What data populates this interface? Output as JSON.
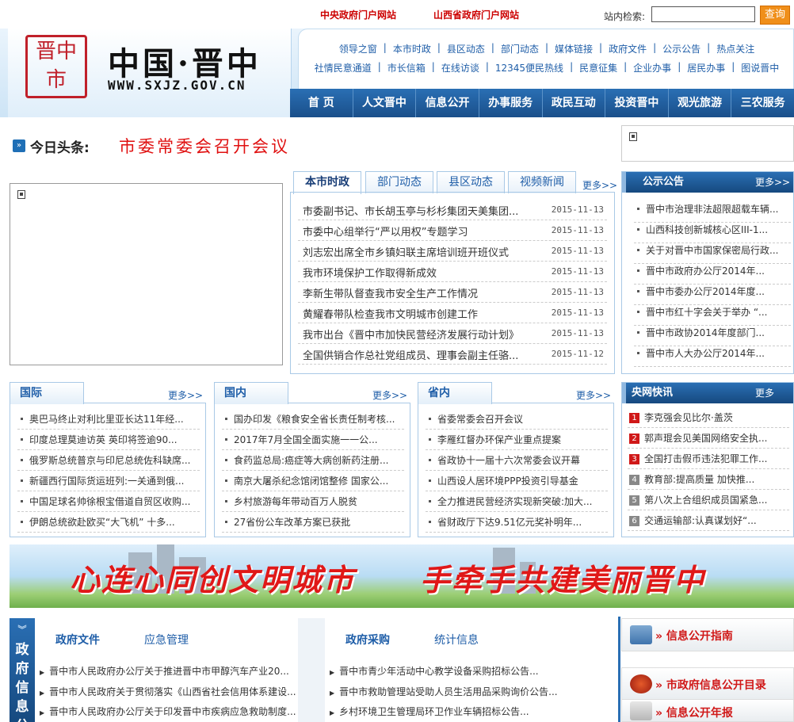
{
  "top": {
    "links": [
      "中央政府门户网站",
      "山西省政府门户网站"
    ],
    "search_label": "站内检索:",
    "search_button": "查询"
  },
  "header": {
    "seal_text": "晋中市",
    "site_name": "中国·晋中",
    "site_url": "WWW.SXJZ.GOV.CN",
    "quick_links_row1": [
      "领导之窗",
      "本市时政",
      "县区动态",
      "部门动态",
      "媒体链接",
      "政府文件",
      "公示公告",
      "热点关注"
    ],
    "quick_links_row2": [
      "社情民意通道",
      "市长信箱",
      "在线访谈",
      "12345便民热线",
      "民意征集",
      "企业办事",
      "居民办事",
      "图说晋中"
    ]
  },
  "nav": [
    "首 页",
    "人文晋中",
    "信息公开",
    "办事服务",
    "政民互动",
    "投资晋中",
    "观光旅游",
    "三农服务"
  ],
  "headline": {
    "label": "今日头条:",
    "title": "市委常委会召开会议"
  },
  "tabs": {
    "labels": [
      "本市时政",
      "部门动态",
      "县区动态",
      "视频新闻"
    ],
    "more": "更多>>",
    "news": [
      {
        "title": "市委副书记、市长胡玉亭与杉杉集团天美集团...",
        "date": "2015-11-13"
      },
      {
        "title": "市委中心组举行“严以用权”专题学习",
        "date": "2015-11-13"
      },
      {
        "title": "刘志宏出席全市乡镇妇联主席培训班开班仪式",
        "date": "2015-11-13"
      },
      {
        "title": "我市环境保护工作取得新成效",
        "date": "2015-11-13"
      },
      {
        "title": "李新生带队督查我市安全生产工作情况",
        "date": "2015-11-13"
      },
      {
        "title": "黄耀春带队检查我市文明城市创建工作",
        "date": "2015-11-13"
      },
      {
        "title": "我市出台《晋中市加快民营经济发展行动计划》",
        "date": "2015-11-13"
      },
      {
        "title": "全国供销合作总社党组成员、理事会副主任骆...",
        "date": "2015-11-12"
      }
    ]
  },
  "notice": {
    "title": "公示公告",
    "more": "更多>>",
    "items": [
      "晋中市治理非法超限超载车辆...",
      "山西科技创新城核心区III-1...",
      "关于对晋中市国家保密局行政...",
      "晋中市政府办公厅2014年...",
      "晋中市委办公厅2014年度...",
      "晋中市红十字会关于举办 “...",
      "晋中市政协2014年度部门...",
      "晋中市人大办公厅2014年..."
    ]
  },
  "columns": [
    {
      "title": "国际",
      "more": "更多>>",
      "items": [
        "奥巴马终止对利比里亚长达11年经...",
        "印度总理莫迪访英 英印将签逾90...",
        "俄罗斯总统普京与印尼总统佐科缺席...",
        "新疆西行国际货运班列:一关通到俄...",
        "中国足球名帅徐根宝借道自贸区收购...",
        "伊朗总统欲赴欧买“大飞机” 十多..."
      ]
    },
    {
      "title": "国内",
      "more": "更多>>",
      "items": [
        "国办印发《粮食安全省长责任制考核...",
        "2017年7月全国全面实施一一公...",
        "食药监总局:癌症等大病创新药注册...",
        "南京大屠杀纪念馆闭馆整修 国家公...",
        "乡村旅游每年带动百万人脱贫",
        "27省份公车改革方案已获批"
      ]
    },
    {
      "title": "省内",
      "more": "更多>>",
      "items": [
        "省委常委会召开会议",
        "李雁红督办环保产业重点提案",
        "省政协十一届十六次常委会议开幕",
        "山西设人居环境PPP投资引导基金",
        "全力推进民营经济实现新突破:加大...",
        "省财政厅下达9.51亿元奖补明年..."
      ]
    }
  ],
  "flash": {
    "title": "央网快讯",
    "more": "更多",
    "items": [
      {
        "num": "1",
        "text": "李克强会见比尔·盖茨",
        "color": "#d01818"
      },
      {
        "num": "2",
        "text": "郭声琨会见美国网络安全执...",
        "color": "#d01818"
      },
      {
        "num": "3",
        "text": "全国打击假币违法犯罪工作...",
        "color": "#d01818"
      },
      {
        "num": "4",
        "text": "教育部:提高质量 加快推...",
        "color": "#888888"
      },
      {
        "num": "5",
        "text": "第八次上合组织成员国紧急...",
        "color": "#888888"
      },
      {
        "num": "6",
        "text": "交通运输部:认真谋划好“...",
        "color": "#888888"
      }
    ]
  },
  "banner": {
    "left_text": "心连心同创文明城市",
    "right_text": "手牵手共建美丽晋中"
  },
  "gov": {
    "side_label": "政府信息公",
    "chevron": "︾",
    "tabs_left": [
      "政府文件",
      "应急管理"
    ],
    "tabs_right": [
      "政府采购",
      "统计信息"
    ],
    "left_items": [
      "晋中市人民政府办公厅关于推进晋中市甲醇汽车产业20...",
      "晋中市人民政府关于贯彻落实《山西省社会信用体系建设...",
      "晋中市人民政府办公厅关于印发晋中市疾病应急救助制度..."
    ],
    "right_items": [
      "晋中市青少年活动中心教学设备采购招标公告...",
      "晋中市救助管理站受助人员生活用品采购询价公告...",
      "乡村环境卫生管理局环卫作业车辆招标公告..."
    ]
  },
  "info_links": [
    "» 信息公开指南",
    "» 市政府信息公开目录",
    "» 信息公开年报"
  ],
  "colors": {
    "brand_blue": "#1f5ea8",
    "nav_blue": "#1a4f8a",
    "headline_red": "#e01010",
    "accent_orange": "#f08f1a"
  }
}
